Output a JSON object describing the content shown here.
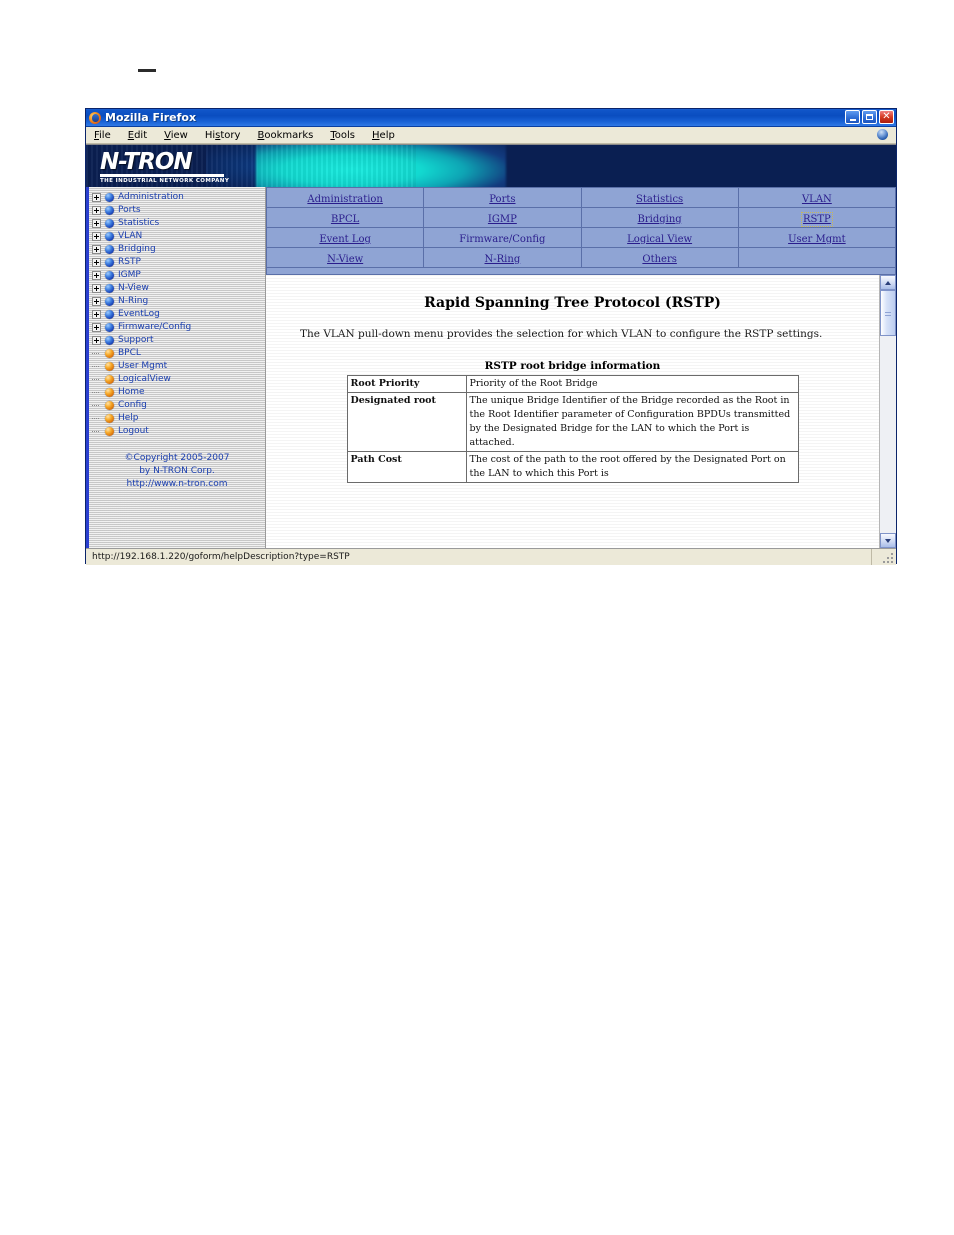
{
  "window": {
    "title": "Mozilla Firefox",
    "controls": {
      "minimize": "_",
      "maximize": "□",
      "close": "×"
    }
  },
  "menubar": {
    "items": [
      "File",
      "Edit",
      "View",
      "History",
      "Bookmarks",
      "Tools",
      "Help"
    ]
  },
  "banner": {
    "logo_main": "N-TRON",
    "logo_sub": "THE INDUSTRIAL NETWORK COMPANY",
    "color_cyan": "#12d9d0",
    "color_navy": "#0a1f52"
  },
  "sidebar": {
    "tree": [
      {
        "label": "Administration",
        "type": "branch"
      },
      {
        "label": "Ports",
        "type": "branch"
      },
      {
        "label": "Statistics",
        "type": "branch"
      },
      {
        "label": "VLAN",
        "type": "branch"
      },
      {
        "label": "Bridging",
        "type": "branch"
      },
      {
        "label": "RSTP",
        "type": "branch"
      },
      {
        "label": "IGMP",
        "type": "branch"
      },
      {
        "label": "N-View",
        "type": "branch"
      },
      {
        "label": "N-Ring",
        "type": "branch"
      },
      {
        "label": "EventLog",
        "type": "branch"
      },
      {
        "label": "Firmware/Config",
        "type": "branch"
      },
      {
        "label": "Support",
        "type": "branch"
      },
      {
        "label": "BPCL",
        "type": "leaf"
      },
      {
        "label": "User Mgmt",
        "type": "leaf"
      },
      {
        "label": "LogicalView",
        "type": "leaf"
      },
      {
        "label": "Home",
        "type": "leaf"
      },
      {
        "label": "Config",
        "type": "leaf"
      },
      {
        "label": "Help",
        "type": "leaf"
      },
      {
        "label": "Logout",
        "type": "leaf"
      }
    ],
    "copyright": {
      "line1": "©Copyright 2005-2007",
      "line2": "by N-TRON Corp.",
      "line3": "http://www.n-tron.com"
    },
    "link_color": "#1b3fb0"
  },
  "navtable": {
    "bg_color": "#8fa4d4",
    "link_color": "#2a1d8c",
    "rows": [
      [
        {
          "label": "Administration",
          "linked": true,
          "focused": false
        },
        {
          "label": "Ports",
          "linked": true,
          "focused": false
        },
        {
          "label": "Statistics",
          "linked": true,
          "focused": false
        },
        {
          "label": "VLAN",
          "linked": true,
          "focused": false
        }
      ],
      [
        {
          "label": "BPCL",
          "linked": true,
          "focused": false
        },
        {
          "label": "IGMP",
          "linked": true,
          "focused": false
        },
        {
          "label": "Bridging",
          "linked": true,
          "focused": false
        },
        {
          "label": "RSTP",
          "linked": true,
          "focused": true
        }
      ],
      [
        {
          "label": "Event Log",
          "linked": true,
          "focused": false
        },
        {
          "label": "Firmware/Config",
          "linked": false,
          "focused": false
        },
        {
          "label": "Logical View",
          "linked": true,
          "focused": false
        },
        {
          "label": "User Mgmt",
          "linked": true,
          "focused": false
        }
      ],
      [
        {
          "label": "N-View",
          "linked": true,
          "focused": false
        },
        {
          "label": "N-Ring",
          "linked": true,
          "focused": false
        },
        {
          "label": "Others",
          "linked": true,
          "focused": false
        },
        {
          "label": "",
          "linked": false,
          "focused": false
        }
      ]
    ]
  },
  "document": {
    "heading": "Rapid Spanning Tree Protocol (RSTP)",
    "intro": "The VLAN pull-down menu provides the selection for which VLAN to configure the RSTP settings.",
    "table_caption": "RSTP root bridge information",
    "table_rows": [
      {
        "term": "Root Priority",
        "definition": "Priority of the Root Bridge"
      },
      {
        "term": "Designated root",
        "definition": "The unique Bridge Identifier of the Bridge recorded as the Root in the Root Identifier parameter of Configuration BPDUs transmitted by the Designated Bridge for the LAN to which the Port is attached."
      },
      {
        "term": "Path Cost",
        "definition": "The cost of the path to the root offered by the Designated Port on the LAN to which this Port is"
      }
    ]
  },
  "statusbar": {
    "url": "http://192.168.1.220/goform/helpDescription?type=RSTP"
  }
}
